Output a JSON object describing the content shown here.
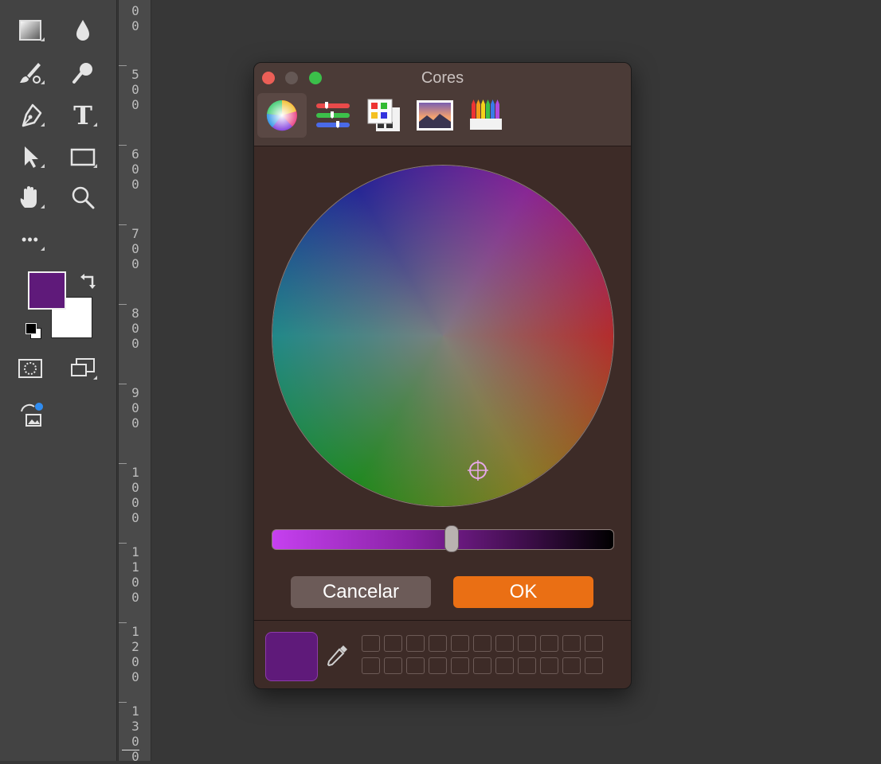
{
  "toolbar": {
    "foreground_color": "#5f1a7a",
    "background_color": "#ffffff",
    "tools": [
      {
        "name": "gradient-tool",
        "icon": "gradient-icon"
      },
      {
        "name": "blur-tool",
        "icon": "drop-icon"
      },
      {
        "name": "brush-tool",
        "icon": "brush-icon"
      },
      {
        "name": "dodge-tool",
        "icon": "dodge-icon"
      },
      {
        "name": "pen-tool",
        "icon": "pen-icon"
      },
      {
        "name": "type-tool",
        "icon": "type-icon",
        "glyph": "T"
      },
      {
        "name": "path-selection-tool",
        "icon": "arrow-icon"
      },
      {
        "name": "rectangle-tool",
        "icon": "rectangle-icon"
      },
      {
        "name": "hand-tool",
        "icon": "hand-icon"
      },
      {
        "name": "zoom-tool",
        "icon": "magnifier-icon"
      },
      {
        "name": "more-tools",
        "icon": "ellipsis-icon",
        "glyph": "•••"
      }
    ]
  },
  "ruler": {
    "marks": [
      "0\n0",
      "5\n0\n0",
      "6\n0\n0",
      "7\n0\n0",
      "8\n0\n0",
      "9\n0\n0",
      "1\n0\n0\n0",
      "1\n1\n0\n0",
      "1\n2\n0\n0",
      "1\n3\n0\n0"
    ]
  },
  "dialog": {
    "title": "Cores",
    "tabs": [
      "color-wheel",
      "color-sliders",
      "color-palettes",
      "image-palettes",
      "pencils"
    ],
    "active_tab": "color-wheel",
    "brightness": 0.53,
    "cancel_label": "Cancelar",
    "ok_label": "OK",
    "current_color": "#5f1a7a",
    "accent": "#ea6f14",
    "swatch_rows": 2,
    "swatch_cols": 11
  }
}
